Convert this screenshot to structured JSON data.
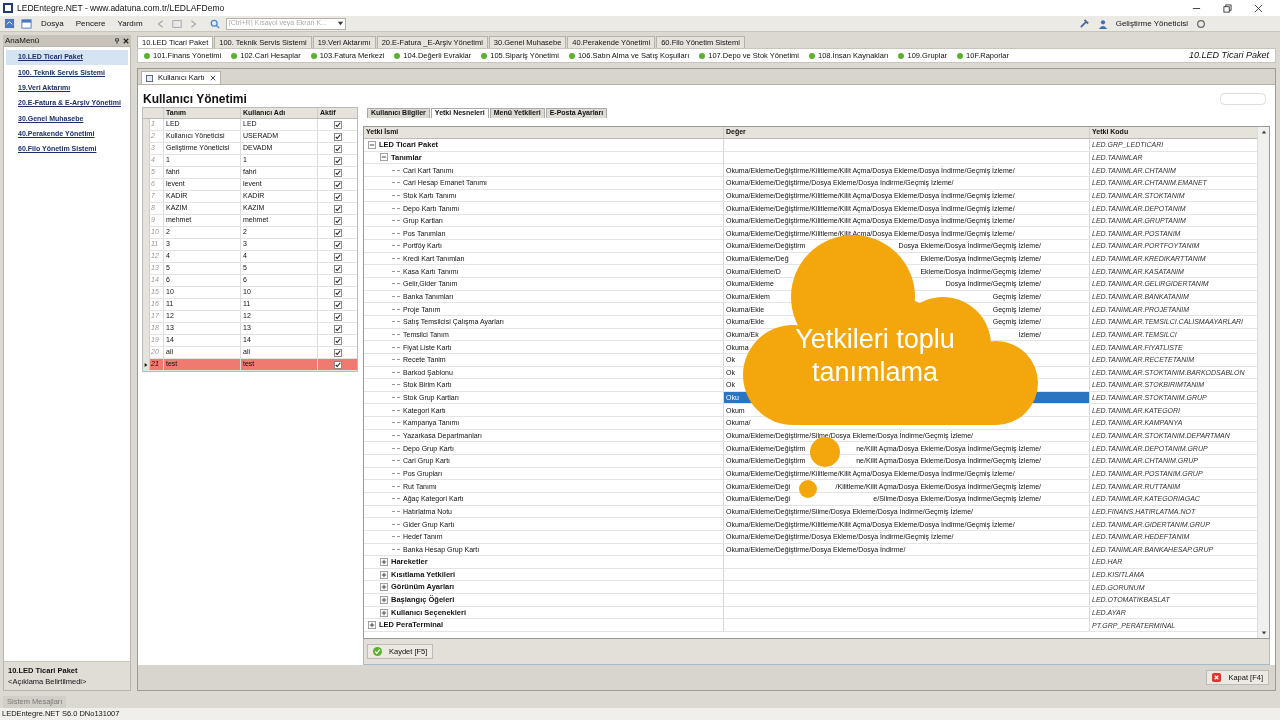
{
  "window": {
    "title": "LEDEntegre.NET - www.adatuna.com.tr/LEDLAFDemo"
  },
  "menu": [
    "Dosya",
    "Pencere",
    "Yardım"
  ],
  "search": {
    "placeholder": "[Ctrl+R] Kısayol veya Ekran K..."
  },
  "user": {
    "name": "Geliştirme Yöneticisi"
  },
  "sidebar": {
    "title": "AnaMenü",
    "items": [
      {
        "label": "10.LED Ticari Paket",
        "selected": true
      },
      {
        "label": "100. Teknik Servis Sistemi",
        "selected": false
      },
      {
        "label": "19.Veri Aktarımı",
        "selected": false
      },
      {
        "label": "20.E-Fatura & E-Arşiv Yönetimi",
        "selected": false
      },
      {
        "label": "30.Genel Muhasebe",
        "selected": false
      },
      {
        "label": "40.Perakende Yönetimi",
        "selected": false
      },
      {
        "label": "60.Filo Yönetim Sistemi",
        "selected": false
      }
    ],
    "footer_title": "10.LED Ticari Paket",
    "footer_note": "<Açıklama Belirtilmedi>"
  },
  "module_tabs": [
    {
      "label": "10.LED Ticari Paket",
      "selected": true
    },
    {
      "label": "100. Teknik Servis Sistemi",
      "selected": false
    },
    {
      "label": "19.Veri Aktarımı",
      "selected": false
    },
    {
      "label": "20.E-Fatura _E-Arşiv Yönetimi",
      "selected": false
    },
    {
      "label": "30.Genel Muhasebe",
      "selected": false
    },
    {
      "label": "40.Perakende Yönetimi",
      "selected": false
    },
    {
      "label": "60.Filo Yönetim Sistemi",
      "selected": false
    }
  ],
  "submenu": [
    "101.Finans Yönetimi",
    "102.Cari Hesaplar",
    "103.Fatura Merkezi",
    "104.Değerli Evraklar",
    "105.Sipariş Yönetimi",
    "106.Satın Alma ve Satış Koşulları",
    "107.Depo ve Stok Yönetimi",
    "108.İnsan Kaynakları",
    "109.Gruplar",
    "10F.Raporlar"
  ],
  "package_label": "10.LED Ticari Paket",
  "document_tab": "Kullanıcı Kartı",
  "page_title": "Kullanıcı Yönetimi",
  "users": {
    "columns": [
      "Tanım",
      "Kullanıcı Adı",
      "Aktif"
    ],
    "rows": [
      {
        "no": "1",
        "name": "LED",
        "username": "LED",
        "active": true,
        "selected": false
      },
      {
        "no": "2",
        "name": "Kullanıcı Yöneticisi",
        "username": "USERADM",
        "active": true,
        "selected": false
      },
      {
        "no": "3",
        "name": "Geliştirme Yöneticisi",
        "username": "DEVADM",
        "active": true,
        "selected": false
      },
      {
        "no": "4",
        "name": "1",
        "username": "1",
        "active": true,
        "selected": false
      },
      {
        "no": "5",
        "name": "fahri",
        "username": "fahri",
        "active": true,
        "selected": false
      },
      {
        "no": "6",
        "name": "levent",
        "username": "levent",
        "active": true,
        "selected": false
      },
      {
        "no": "7",
        "name": "KADİR",
        "username": "KADİR",
        "active": true,
        "selected": false
      },
      {
        "no": "8",
        "name": "KAZIM",
        "username": "KAZIM",
        "active": true,
        "selected": false
      },
      {
        "no": "9",
        "name": "mehmet",
        "username": "mehmet",
        "active": true,
        "selected": false
      },
      {
        "no": "10",
        "name": "2",
        "username": "2",
        "active": true,
        "selected": false
      },
      {
        "no": "11",
        "name": "3",
        "username": "3",
        "active": true,
        "selected": false
      },
      {
        "no": "12",
        "name": "4",
        "username": "4",
        "active": true,
        "selected": false
      },
      {
        "no": "13",
        "name": "5",
        "username": "5",
        "active": true,
        "selected": false
      },
      {
        "no": "14",
        "name": "6",
        "username": "6",
        "active": true,
        "selected": false
      },
      {
        "no": "15",
        "name": "10",
        "username": "10",
        "active": true,
        "selected": false
      },
      {
        "no": "16",
        "name": "11",
        "username": "11",
        "active": true,
        "selected": false
      },
      {
        "no": "17",
        "name": "12",
        "username": "12",
        "active": true,
        "selected": false
      },
      {
        "no": "18",
        "name": "13",
        "username": "13",
        "active": true,
        "selected": false
      },
      {
        "no": "19",
        "name": "14",
        "username": "14",
        "active": true,
        "selected": false
      },
      {
        "no": "20",
        "name": "ali",
        "username": "ali",
        "active": true,
        "selected": false
      },
      {
        "no": "21",
        "name": "test",
        "username": "test",
        "active": true,
        "selected": true
      }
    ]
  },
  "panel_tabs": [
    {
      "label": "Kullanıcı Bilgiler",
      "selected": false
    },
    {
      "label": "Yetki Nesneleri",
      "selected": true
    },
    {
      "label": "Menü Yetkileri",
      "selected": false
    },
    {
      "label": "E-Posta Ayarları",
      "selected": false
    }
  ],
  "permissions": {
    "columns": [
      "Yetki İsmi",
      "Değer",
      "Yetki Kodu"
    ],
    "rows": [
      {
        "name": "LED Ticari Paket",
        "code": "LED.GRP_LEDTICARI",
        "expanded": true,
        "selected": false,
        "children": [
          {
            "name": "Tanımlar",
            "code": "LED.TANIMLAR",
            "expanded": true,
            "selected": false,
            "children": [
              {
                "name": "Cari Kart Tanımı",
                "value": "Okuma/Ekleme/Değiştirme/Kilitleme/Kilit Açma/Dosya Ekleme/Dosya İndirme/Geçmiş İzleme/",
                "code": "LED.TANIMLAR.CHTANIM",
                "selected": false
              },
              {
                "name": "Cari Hesap Emanet Tanımı",
                "value": "Okuma/Ekleme/Değiştirme/Dosya Ekleme/Dosya İndirme/Geçmiş İzleme/",
                "code": "LED.TANIMLAR.CHTANIM.EMANET",
                "selected": false
              },
              {
                "name": "Stok Kartı Tanımı",
                "value": "Okuma/Ekleme/Değiştirme/Kilitleme/Kilit Açma/Dosya Ekleme/Dosya İndirme/Geçmiş İzleme/",
                "code": "LED.TANIMLAR.STOKTANIM",
                "selected": false
              },
              {
                "name": "Depo Kartı Tanımı",
                "value": "Okuma/Ekleme/Değiştirme/Kilitleme/Kilit Açma/Dosya Ekleme/Dosya İndirme/Geçmiş İzleme/",
                "code": "LED.TANIMLAR.DEPOTANIM",
                "selected": false
              },
              {
                "name": "Grup Kartları",
                "value": "Okuma/Ekleme/Değiştirme/Kilitleme/Kilit Açma/Dosya Ekleme/Dosya İndirme/Geçmiş İzleme/",
                "code": "LED.TANIMLAR.GRUPTANIM",
                "selected": false
              },
              {
                "name": "Pos Tanımları",
                "value": "Okuma/Ekleme/Değiştirme/Kilitleme/Kilit Açma/Dosya Ekleme/Dosya İndirme/Geçmiş İzleme/",
                "code": "LED.TANIMLAR.POSTANIM",
                "selected": false
              },
              {
                "name": "Portföy Kartı",
                "value_start": "Okuma/Ekleme/Değiştirm",
                "value_end": "Dosya Ekleme/Dosya İndirme/Geçmiş İzleme/",
                "code": "LED.TANIMLAR.PORTFOYTANIM",
                "selected": false
              },
              {
                "name": "Kredi Kart Tanımları",
                "value_start": "Okuma/Ekleme/Değ",
                "value_end": "Ekleme/Dosya İndirme/Geçmiş İzleme/",
                "code": "LED.TANIMLAR.KREDIKARTTANIM",
                "selected": false
              },
              {
                "name": "Kasa Kartı Tanımı",
                "value_start": "Okuma/Ekleme/D",
                "value_end": "Ekleme/Dosya İndirme/Geçmiş İzleme/",
                "code": "LED.TANIMLAR.KASATANIM",
                "selected": false
              },
              {
                "name": "Gelir,Gider Tanım",
                "value_start": "Okuma/Ekleme",
                "value_end": "Dosya İndirme/Geçmiş İzleme/",
                "code": "LED.TANIMLAR.GELIRGIDERTANIM",
                "selected": false
              },
              {
                "name": "Banka Tanımları",
                "value_start": "Okuma/Eklem",
                "value_end": "Geçmiş İzleme/",
                "code": "LED.TANIMLAR.BANKATANIM",
                "selected": false
              },
              {
                "name": "Proje Tanım",
                "value_start": "Okuma/Ekle",
                "value_end": "Geçmiş İzleme/",
                "code": "LED.TANIMLAR.PROJETANIM",
                "selected": false
              },
              {
                "name": "Satış Temsilcisi Çalışma Ayarları",
                "value_start": "Okuma/Ekle",
                "value_end": "Geçmiş İzleme/",
                "code": "LED.TANIMLAR.TEMSILCI.CALISMAAYARLARI",
                "selected": false
              },
              {
                "name": "Temsilci Tanım",
                "value_start": "Okuma/Ek",
                "value_end": "İzleme/",
                "code": "LED.TANIMLAR.TEMSILCI",
                "selected": false
              },
              {
                "name": "Fiyat Liste Kartı",
                "value_start": "Okuma",
                "code": "LED.TANIMLAR.FIYATLISTE",
                "selected": false
              },
              {
                "name": "Recete Tanim",
                "value_start": "Ok",
                "code": "LED.TANIMLAR.RECETETANIM",
                "selected": false
              },
              {
                "name": "Barkod Şablonu",
                "value_start": "Ok",
                "code": "LED.TANIMLAR.STOKTANIM.BARKODSABLON",
                "selected": false
              },
              {
                "name": "Stok Birim Kartı",
                "value_start": "Ok",
                "code": "LED.TANIMLAR.STOKBIRIMTANIM",
                "selected": false
              },
              {
                "name": "Stok Grup Kartları",
                "value_start": "Oku",
                "code": "LED.TANIMLAR.STOKTANIM.GRUP",
                "selected": true
              },
              {
                "name": "Kategori Kartı",
                "value_start": "Okum",
                "code": "LED.TANIMLAR.KATEGORI",
                "selected": false
              },
              {
                "name": "Kampanya Tanımı",
                "value_start": "Okuma/",
                "code": "LED.TANIMLAR.KAMPANYA",
                "selected": false
              },
              {
                "name": "Yazarkasa Departmanları",
                "value": "Okuma/Ekleme/Değiştirme/Silme/Dosya Ekleme/Dosya İndirme/Geçmiş İzleme/",
                "code": "LED.TANIMLAR.STOKTANIM.DEPARTMAN",
                "selected": false
              },
              {
                "name": "Depo Grup Kartı",
                "value_start": "Okuma/Ekleme/Değiştirm",
                "value_end": "ne/Kilit Açma/Dosya Ekleme/Dosya İndirme/Geçmiş İzleme/",
                "code": "LED.TANIMLAR.DEPOTANIM.GRUP",
                "selected": false
              },
              {
                "name": "Cari Grup Kartı",
                "value_start": "Okuma/Ekleme/Değiştirm",
                "value_end": "ne/Kilit Açma/Dosya Ekleme/Dosya İndirme/Geçmiş İzleme/",
                "code": "LED.TANIMLAR.CHTANIM.GRUP",
                "selected": false
              },
              {
                "name": "Pos Grupları",
                "value": "Okuma/Ekleme/Değiştirme/Kilitleme/Kilit Açma/Dosya Ekleme/Dosya İndirme/Geçmiş İzleme/",
                "code": "LED.TANIMLAR.POSTANIM.GRUP",
                "selected": false
              },
              {
                "name": "Rut Tanımı",
                "value_start": "Okuma/Ekleme/Deği",
                "value_end": "/Kilitleme/Kilit Açma/Dosya Ekleme/Dosya İndirme/Geçmiş İzleme/",
                "code": "LED.TANIMLAR.RUTTANIM",
                "selected": false
              },
              {
                "name": "Ağaç Kategori Kartı",
                "value_start": "Okuma/Ekleme/Deği",
                "value_end": "e/Silme/Dosya Ekleme/Dosya İndirme/Geçmiş İzleme/",
                "code": "LED.TANIMLAR.KATEGORIAGAC",
                "selected": false
              },
              {
                "name": "Hatırlatma Notu",
                "value": "Okuma/Ekleme/Değiştirme/Silme/Dosya Ekleme/Dosya İndirme/Geçmiş İzleme/",
                "code": "LED.FINANS.HATIRLATMA.NOT",
                "selected": false
              },
              {
                "name": "Gider Grup Kartı",
                "value": "Okuma/Ekleme/Değiştirme/Kilitleme/Kilit Açma/Dosya Ekleme/Dosya İndirme/Geçmiş İzleme/",
                "code": "LED.TANIMLAR.GIDERTANIM.GRUP",
                "selected": false
              },
              {
                "name": "Hedef Tanım",
                "value": "Okuma/Ekleme/Değiştirme/Dosya Ekleme/Dosya İndirme/Geçmiş İzleme/",
                "code": "LED.TANIMLAR.HEDEFTANIM",
                "selected": false
              },
              {
                "name": "Banka Hesap Grup Kartı",
                "value": "Okuma/Ekleme/Değiştirme/Dosya Ekleme/Dosya İndirme/",
                "code": "LED.TANIMLAR.BANKAHESAP.GRUP",
                "selected": false
              }
            ]
          },
          {
            "name": "Hareketler",
            "code": "LED.HAR",
            "expanded": false,
            "selected": false
          },
          {
            "name": "Kısıtlama Yetkileri",
            "code": "LED.KISITLAMA",
            "expanded": false,
            "selected": false
          },
          {
            "name": "Görünüm Ayarları",
            "code": "LED.GORUNUM",
            "expanded": false,
            "selected": false
          },
          {
            "name": "Başlangıç Öğeleri",
            "code": "LED.OTOMATIKBASLAT",
            "expanded": false,
            "selected": false
          },
          {
            "name": "Kullanıcı Seçenekleri",
            "code": "LED.AYAR",
            "expanded": false,
            "selected": false
          }
        ]
      },
      {
        "name": "LED PeraTerminal",
        "code": "PT.GRP_PERATERMINAL",
        "expanded": false,
        "selected": false
      }
    ]
  },
  "callout": {
    "text": "Yetkileri toplu tanımlama"
  },
  "buttons": {
    "save": "Kaydet [F5]",
    "close": "Kapat [F4]"
  },
  "messages_tab": "Sistem Mesajları",
  "status_bar": "LEDEntegre.NET S6.0 DNo131007"
}
